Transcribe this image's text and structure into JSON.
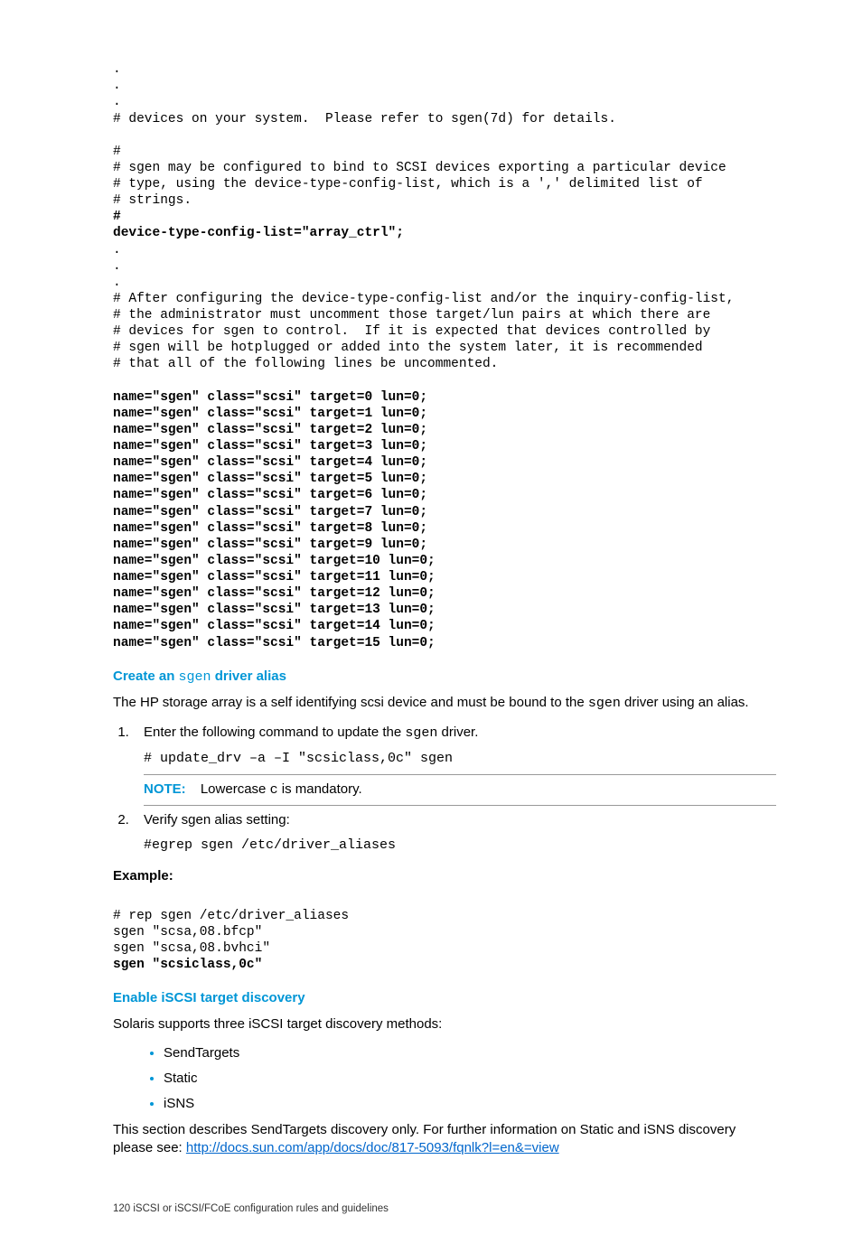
{
  "code_block1": {
    "line1": ".",
    "line2": ".",
    "line3": ".",
    "line4": "# devices on your system.  Please refer to sgen(7d) for details.",
    "line5": "",
    "line6": "#",
    "line7": "# sgen may be configured to bind to SCSI devices exporting a particular device",
    "line8": "# type, using the device-type-config-list, which is a ',' delimited list of",
    "line9": "# strings.",
    "line10": "#",
    "line11": "device-type-config-list=\"array_ctrl\";",
    "line12": ".",
    "line13": ".",
    "line14": ".",
    "line15": "# After configuring the device-type-config-list and/or the inquiry-config-list,",
    "line16": "# the administrator must uncomment those target/lun pairs at which there are",
    "line17": "# devices for sgen to control.  If it is expected that devices controlled by",
    "line18": "# sgen will be hotplugged or added into the system later, it is recommended",
    "line19": "# that all of the following lines be uncommented.",
    "line20": "",
    "line21": "name=\"sgen\" class=\"scsi\" target=0 lun=0;",
    "line22": "name=\"sgen\" class=\"scsi\" target=1 lun=0;",
    "line23": "name=\"sgen\" class=\"scsi\" target=2 lun=0;",
    "line24": "name=\"sgen\" class=\"scsi\" target=3 lun=0;",
    "line25": "name=\"sgen\" class=\"scsi\" target=4 lun=0;",
    "line26": "name=\"sgen\" class=\"scsi\" target=5 lun=0;",
    "line27": "name=\"sgen\" class=\"scsi\" target=6 lun=0;",
    "line28": "name=\"sgen\" class=\"scsi\" target=7 lun=0;",
    "line29": "name=\"sgen\" class=\"scsi\" target=8 lun=0;",
    "line30": "name=\"sgen\" class=\"scsi\" target=9 lun=0;",
    "line31": "name=\"sgen\" class=\"scsi\" target=10 lun=0;",
    "line32": "name=\"sgen\" class=\"scsi\" target=11 lun=0;",
    "line33": "name=\"sgen\" class=\"scsi\" target=12 lun=0;",
    "line34": "name=\"sgen\" class=\"scsi\" target=13 lun=0;",
    "line35": "name=\"sgen\" class=\"scsi\" target=14 lun=0;",
    "line36": "name=\"sgen\" class=\"scsi\" target=15 lun=0;"
  },
  "heading1_pre": "Create an ",
  "heading1_mono": "sgen",
  "heading1_post": " driver alias",
  "para1_pre": "The HP storage array is a self identifying scsi device and must be bound to the ",
  "para1_mono": "sgen",
  "para1_post": " driver using an alias.",
  "step1_pre": "Enter the following command to update the ",
  "step1_mono": "sgen",
  "step1_post": " driver.",
  "cmd1": "# update_drv –a –I \"scsiclass,0c\" sgen",
  "note_label": "NOTE:",
  "note_pre": "Lowercase ",
  "note_mono": "c",
  "note_post": " is mandatory.",
  "step2": "Verify sgen alias setting:",
  "cmd2": "#egrep sgen /etc/driver_aliases",
  "example_label": "Example:",
  "example_code": {
    "l1": "# rep sgen /etc/driver_aliases",
    "l2": "sgen \"scsa,08.bfcp\"",
    "l3": "sgen \"scsa,08.bvhci\"",
    "l4": "sgen \"scsiclass,0c\""
  },
  "heading2": "Enable iSCSI target discovery",
  "para2": "Solaris supports three iSCSI target discovery methods:",
  "bullet1": "SendTargets",
  "bullet2": "Static",
  "bullet3": "iSNS",
  "para3_pre": "This section describes SendTargets discovery only. For further information on Static and iSNS discovery please see: ",
  "para3_link": "http://docs.sun.com/app/docs/doc/817-5093/fqnlk?l=en&=view",
  "footer": "120   iSCSI or iSCSI/FCoE configuration rules and guidelines"
}
